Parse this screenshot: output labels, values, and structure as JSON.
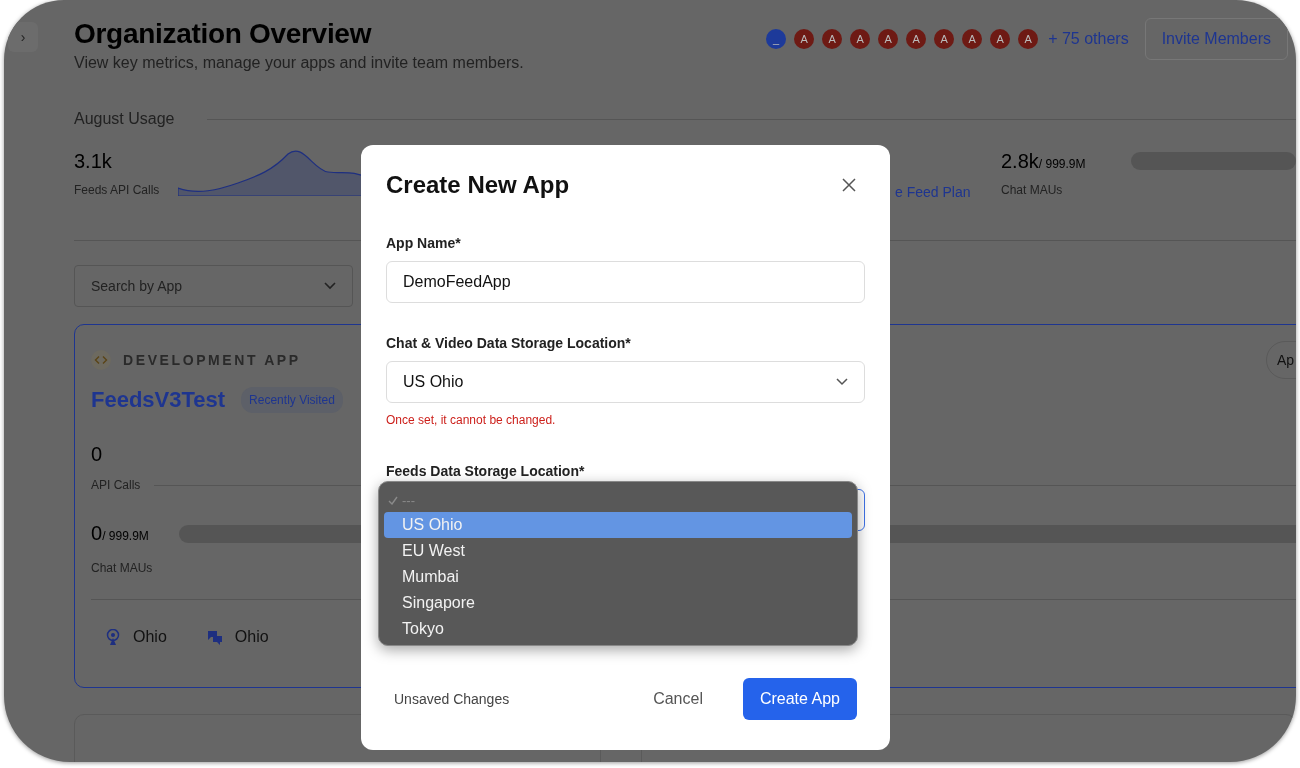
{
  "sidebar_toggle": {
    "label": "›"
  },
  "header": {
    "title": "Organization Overview",
    "subtitle": "View key metrics, manage your apps and invite team members."
  },
  "members": {
    "avatars": [
      {
        "initial": "_",
        "color": "#1d3a9a"
      },
      {
        "initial": "A",
        "color": "#6e1a14"
      },
      {
        "initial": "A",
        "color": "#6e1a14"
      },
      {
        "initial": "A",
        "color": "#6e1a14"
      },
      {
        "initial": "A",
        "color": "#6e1a14"
      },
      {
        "initial": "A",
        "color": "#6e1a14"
      },
      {
        "initial": "A",
        "color": "#6e1a14"
      },
      {
        "initial": "A",
        "color": "#6e1a14"
      },
      {
        "initial": "A",
        "color": "#6e1a14"
      },
      {
        "initial": "A",
        "color": "#6e1a14"
      }
    ],
    "more": "+ 75 others",
    "invite_button": "Invite Members"
  },
  "usage": {
    "title": "August Usage",
    "stats": [
      {
        "kind": "sparkline",
        "value": "3.1k",
        "label": "Feeds API Calls"
      },
      {
        "kind": "link",
        "label": "e Feed Plan"
      },
      {
        "kind": "quota",
        "value": "2.8k",
        "limit": "/ 999.9M",
        "label": "Chat MAUs"
      }
    ]
  },
  "search": {
    "placeholder": "Search by App"
  },
  "app_card": {
    "type": "DEVELOPMENT APP",
    "name": "FeedsV3Test",
    "badge": "Recently Visited",
    "action": "Ap",
    "api_calls": {
      "value": "0",
      "label": "API Calls"
    },
    "chat_maus": {
      "value": "0",
      "limit": "/ 999.9M",
      "label": "Chat MAUs"
    },
    "locations": [
      {
        "kind": "feeds",
        "label": "Ohio"
      },
      {
        "kind": "chat",
        "label": "Ohio"
      }
    ]
  },
  "dialog": {
    "title": "Create New App",
    "fields": [
      {
        "kind": "text",
        "label": "App Name*",
        "value": "DemoFeedApp"
      },
      {
        "kind": "select",
        "label": "Chat & Video Data Storage Location*",
        "value": "US Ohio",
        "note": "Once set, it cannot be changed.",
        "focused": false
      },
      {
        "kind": "select",
        "label": "Feeds Data Storage Location*",
        "focused": true
      }
    ],
    "menu": {
      "options": [
        {
          "label": "---",
          "checked": true,
          "selected": false
        },
        {
          "label": "US Ohio",
          "checked": false,
          "selected": true
        },
        {
          "label": "EU West",
          "checked": false,
          "selected": false
        },
        {
          "label": "Mumbai",
          "checked": false,
          "selected": false
        },
        {
          "label": "Singapore",
          "checked": false,
          "selected": false
        },
        {
          "label": "Tokyo",
          "checked": false,
          "selected": false
        }
      ]
    },
    "status": "Unsaved Changes",
    "buttons": [
      {
        "kind": "secondary",
        "label": "Cancel"
      },
      {
        "kind": "primary",
        "label": "Create App"
      }
    ]
  }
}
